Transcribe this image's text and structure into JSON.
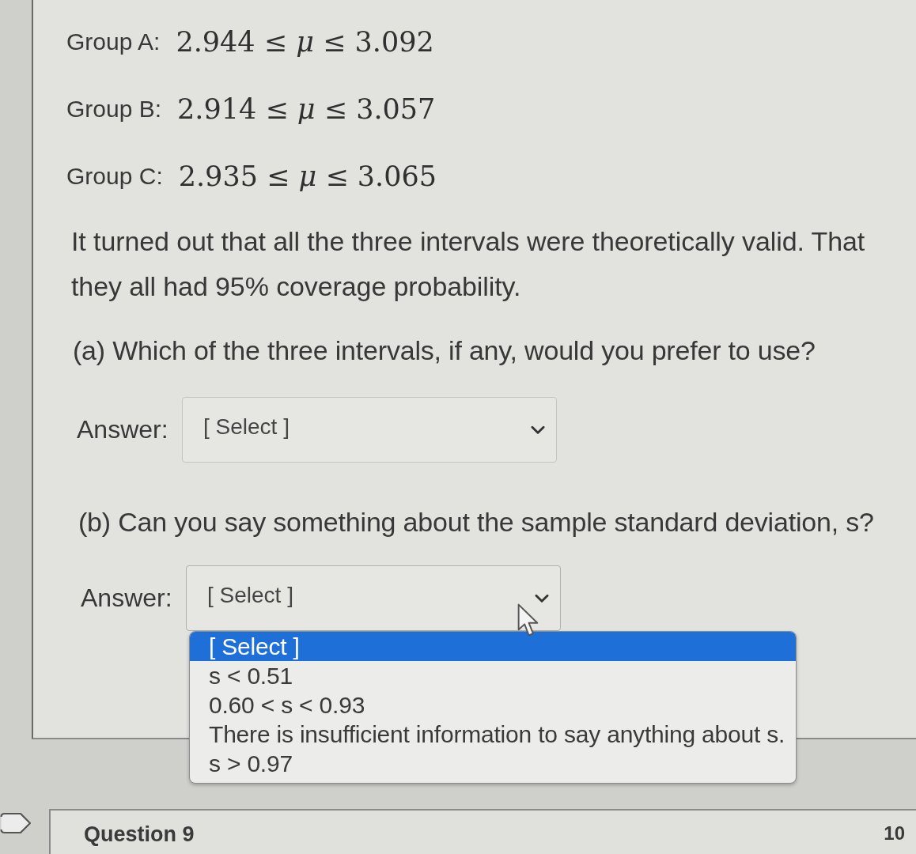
{
  "intervals": [
    {
      "label": "Group A:",
      "math": "2.944 ≤ *μ* ≤ 3.092"
    },
    {
      "label": "Group B:",
      "math": "2.914 ≤ *μ* ≤ 3.057"
    },
    {
      "label": "Group C:",
      "math": "2.935 ≤ *μ* ≤ 3.065"
    }
  ],
  "paragraph": {
    "lines": [
      "It turned out that all the three intervals were theoretically valid. That",
      "they all had 95% coverage probability."
    ]
  },
  "questions": [
    {
      "prompt": "(a) Which of the three intervals, if any, would you prefer to use?",
      "answer_label": "Answer:",
      "select": {
        "value": "[ Select ]",
        "expanded": false
      }
    },
    {
      "prompt": "(b) Can you say something about the sample standard deviation, s?",
      "answer_label": "Answer:",
      "select": {
        "value": "[ Select ]",
        "expanded": true,
        "options": [
          {
            "label": "[ Select ]",
            "selected": true
          },
          {
            "label": "s < 0.51",
            "selected": false
          },
          {
            "label": "0.60 < s < 0.93",
            "selected": false
          },
          {
            "label": "There is insufficient information to say anything about s.",
            "selected": false
          },
          {
            "label": "s > 0.97",
            "selected": false
          }
        ]
      }
    }
  ],
  "next_question": {
    "title": "Question 9",
    "points": "10"
  }
}
